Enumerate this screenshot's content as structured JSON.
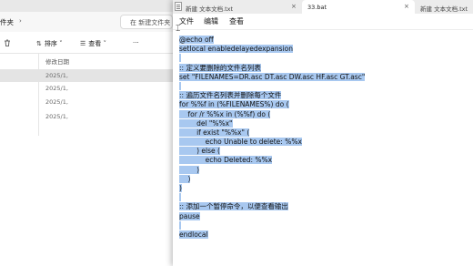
{
  "explorer": {
    "breadcrumb": "件夹",
    "breadcrumb_chevron": "›",
    "search_placeholder": "在 新建文件夹",
    "toolbar": {
      "delete_icon": "trash-icon",
      "sort_label": "排序",
      "view_label": "查看",
      "more_label": "···"
    },
    "list_header": "修改日期",
    "rows": [
      {
        "date": "2025/1,"
      },
      {
        "date": "2025/1,"
      },
      {
        "date": "2025/1,"
      },
      {
        "date": "2025/1,"
      }
    ]
  },
  "notepad": {
    "tabs": [
      {
        "label": "新建 文本文档.txt",
        "active": false
      },
      {
        "label": "33.bat",
        "active": true
      },
      {
        "label": "新建 文本文档.txt",
        "active": false
      }
    ],
    "tab_close": "×",
    "menu": {
      "file": "文件",
      "edit": "编辑",
      "view": "查看"
    },
    "code_lines": [
      "@echo off",
      "setlocal enabledelayedexpansion",
      "",
      ":: 定义要删除的文件名列表",
      "set \"FILENAMES=DR.asc DT.asc DW.asc HF.asc GT.asc\"",
      "",
      ":: 遍历文件名列表并删除每个文件",
      "for %%f in (%FILENAMES%) do (",
      "    for /r %%x in (%%f) do (",
      "        del \"%%x\"",
      "        if exist \"%%x\" (",
      "            echo Unable to delete: %%x",
      "        ) else (",
      "            echo Deleted: %%x",
      "        )",
      "    )",
      ")",
      "",
      ":: 添加一个暂停命令，以便查看输出",
      "pause",
      "",
      "endlocal"
    ]
  }
}
